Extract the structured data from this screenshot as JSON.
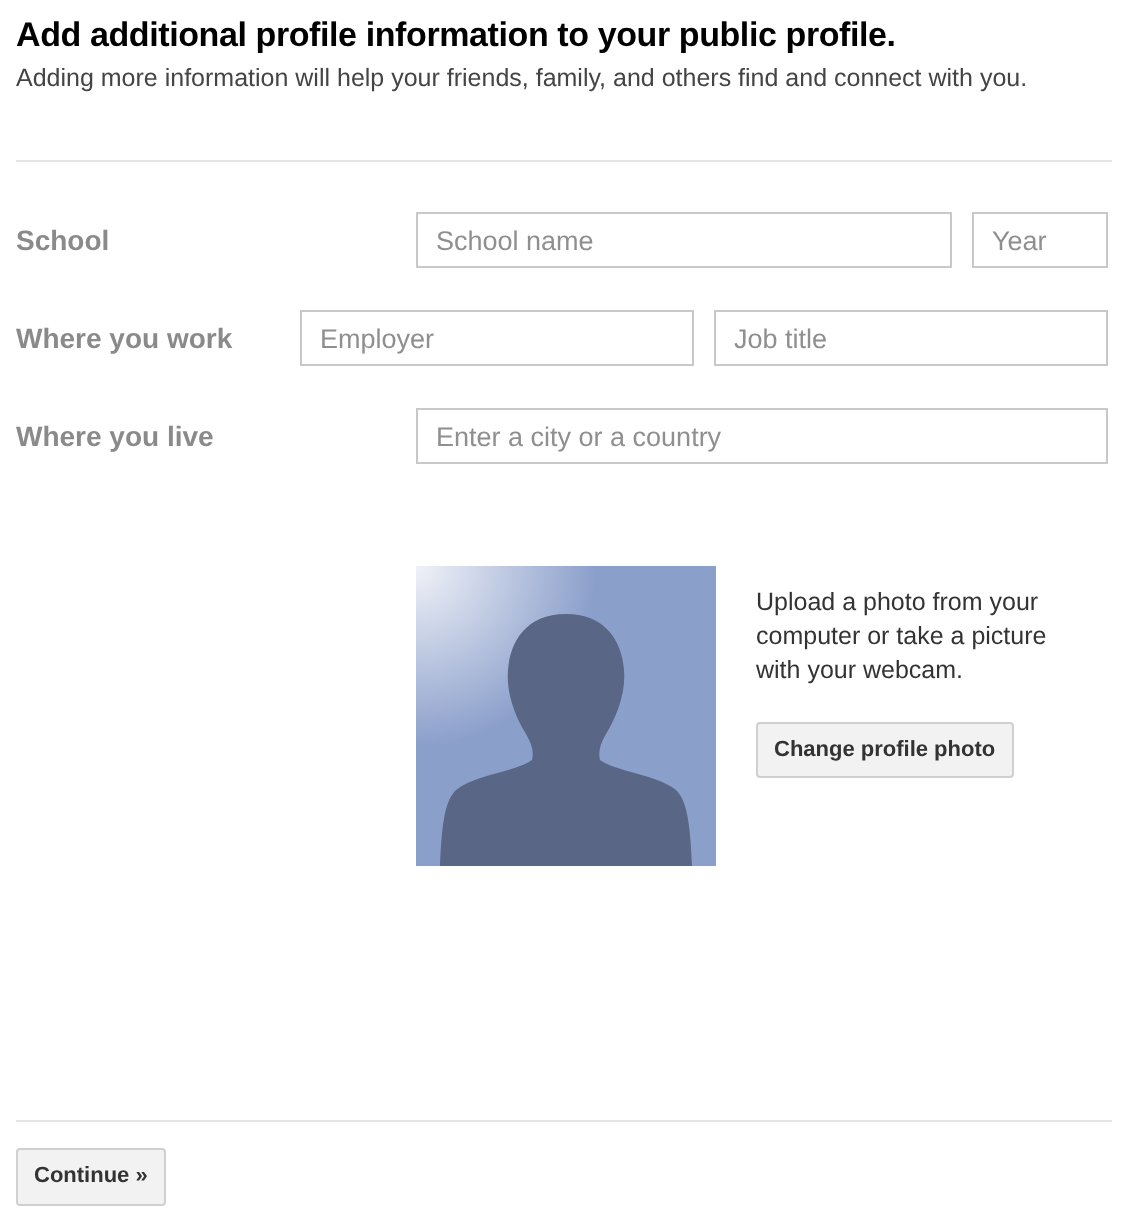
{
  "header": {
    "title": "Add additional profile information to your public profile.",
    "subtitle": "Adding more information will help your friends, family, and others find and connect with you."
  },
  "fields": [
    {
      "label": "School",
      "inputs": [
        {
          "placeholder": "School name",
          "kind": "long"
        },
        {
          "placeholder": "Year",
          "kind": "short"
        }
      ]
    },
    {
      "label": "Where you work",
      "inputs": [
        {
          "placeholder": "Employer",
          "kind": "long"
        },
        {
          "placeholder": "Job title",
          "kind": "long"
        }
      ]
    },
    {
      "label": "Where you live",
      "inputs": [
        {
          "placeholder": "Enter a city or a country",
          "kind": "long"
        }
      ]
    }
  ],
  "photo": {
    "description": "Upload a photo from your computer or take a picture with your webcam.",
    "button": "Change profile photo"
  },
  "footer": {
    "button": "Continue »"
  }
}
